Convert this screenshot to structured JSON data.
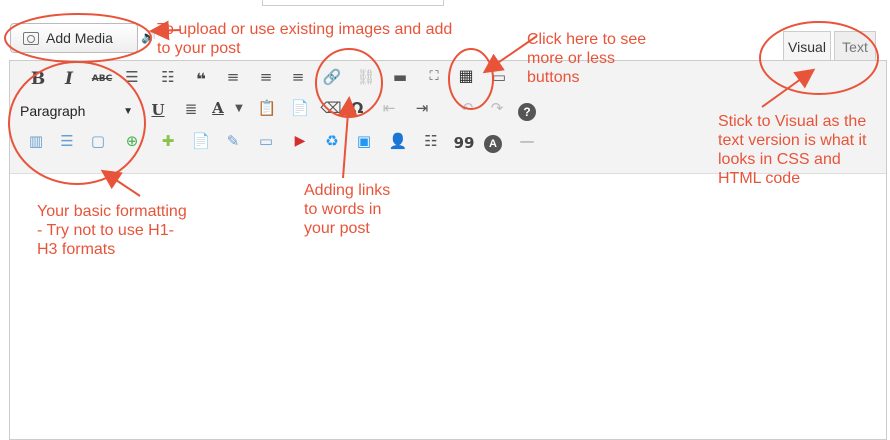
{
  "media": {
    "add_label": "Add Media"
  },
  "tabs": {
    "visual": "Visual",
    "text": "Text"
  },
  "toolbar": {
    "format_select": "Paragraph"
  },
  "annotations": {
    "upload_line1": "To upload or use existing images and add",
    "upload_line2": "to your post",
    "more_line1": "Click here to see",
    "more_line2": "more or less",
    "more_line3": "buttons",
    "visual_line1": "Stick to Visual as the",
    "visual_line2": "text version is what it",
    "visual_line3": "looks in CSS and",
    "visual_line4": "HTML code",
    "links_line1": "Adding links",
    "links_line2": "to words in",
    "links_line3": "your post",
    "format_line1": "Your basic formatting",
    "format_line2": "- Try not to use H1-",
    "format_line3": "H3 formats"
  },
  "colors": {
    "annotation": "#e8543a"
  },
  "icons": {
    "row1": [
      "bold-icon",
      "italic-icon",
      "strikethrough-icon",
      "bullet-list-icon",
      "numbered-list-icon",
      "blockquote-icon",
      "align-left-icon",
      "align-center-icon",
      "align-right-icon",
      "insert-link-icon",
      "unlink-icon",
      "read-more-icon",
      "fullscreen-icon",
      "toolbar-toggle-icon",
      "distraction-free-icon"
    ],
    "row2": [
      "underline-icon",
      "justify-icon",
      "text-color-icon",
      "paste-text-icon",
      "paste-word-icon",
      "clear-format-icon",
      "special-char-icon",
      "outdent-icon",
      "indent-icon",
      "undo-icon",
      "redo-icon",
      "help-icon"
    ],
    "row3": [
      "table-icon",
      "rows-icon",
      "box-icon",
      "add-icon",
      "shortcode-icon",
      "page-icon",
      "edit-icon",
      "frame-icon",
      "youtube-icon",
      "recycle-icon",
      "image-icon",
      "person-icon",
      "list-icon",
      "quote-icon",
      "font-icon",
      "line-icon"
    ]
  },
  "glyphs": {
    "bold": "B",
    "italic": "I",
    "strike": "ABC",
    "quote": "66",
    "special_char": "Ω",
    "close_quote": "99",
    "font": "A",
    "underline": "U",
    "text_color": "A"
  }
}
